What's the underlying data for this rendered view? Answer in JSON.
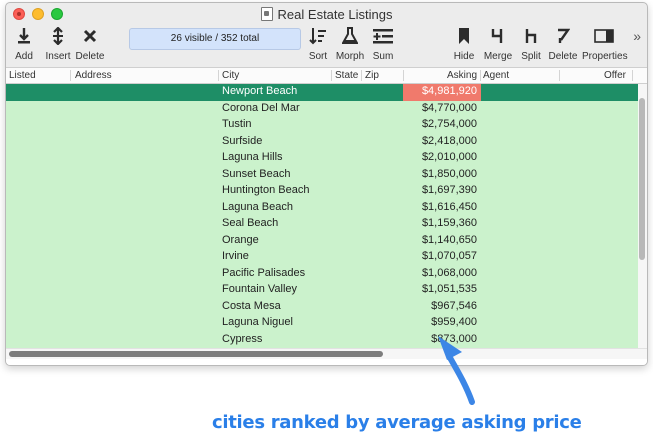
{
  "window": {
    "title": "Real Estate Listings"
  },
  "toolbar": {
    "add": "Add",
    "insert": "Insert",
    "delete": "Delete",
    "status": "26 visible / 352 total",
    "sort": "Sort",
    "morph": "Morph",
    "sum": "Sum",
    "hide": "Hide",
    "merge": "Merge",
    "split": "Split",
    "delete_col": "Delete",
    "properties": "Properties",
    "overflow": "»"
  },
  "columns": [
    "Listed",
    "Address",
    "City",
    "State",
    "Zip",
    "Asking",
    "Agent",
    "Offer"
  ],
  "rows": [
    {
      "city": "Newport Beach",
      "asking": "$4,981,920"
    },
    {
      "city": "Corona Del Mar",
      "asking": "$4,770,000"
    },
    {
      "city": "Tustin",
      "asking": "$2,754,000"
    },
    {
      "city": "Surfside",
      "asking": "$2,418,000"
    },
    {
      "city": "Laguna Hills",
      "asking": "$2,010,000"
    },
    {
      "city": "Sunset Beach",
      "asking": "$1,850,000"
    },
    {
      "city": "Huntington Beach",
      "asking": "$1,697,390"
    },
    {
      "city": "Laguna Beach",
      "asking": "$1,616,450"
    },
    {
      "city": "Seal Beach",
      "asking": "$1,159,360"
    },
    {
      "city": "Orange",
      "asking": "$1,140,650"
    },
    {
      "city": "Irvine",
      "asking": "$1,070,057"
    },
    {
      "city": "Pacific Palisades",
      "asking": "$1,068,000"
    },
    {
      "city": "Fountain Valley",
      "asking": "$1,051,535"
    },
    {
      "city": "Costa Mesa",
      "asking": "$967,546"
    },
    {
      "city": "Laguna Niguel",
      "asking": "$959,400"
    },
    {
      "city": "Cypress",
      "asking": "$873,000"
    }
  ],
  "caption": "cities ranked by average asking price",
  "colors": {
    "row_bg": "#cbf2cc",
    "selected_row": "#1e8e66",
    "highlight_cell": "#f07a6c",
    "caption": "#2a7fe8"
  }
}
